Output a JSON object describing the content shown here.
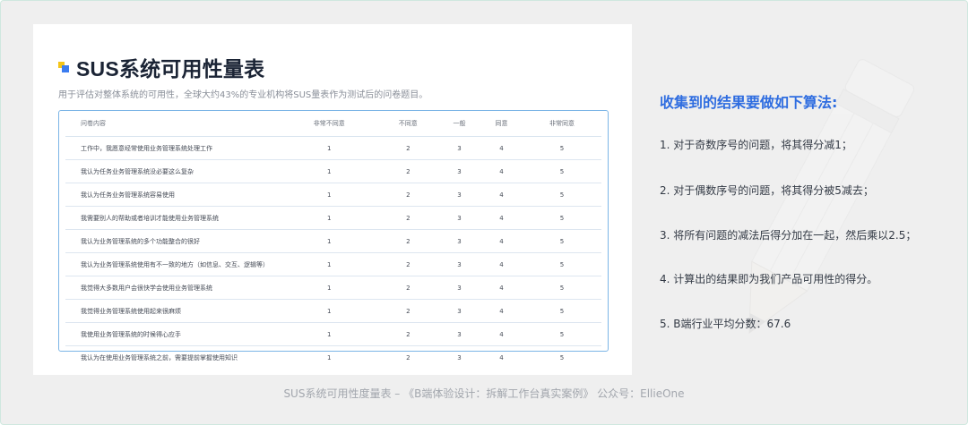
{
  "card": {
    "title": "SUS系统可用性量表",
    "subtitle": "用于评估对整体系统的可用性，全球大约43%的专业机构将SUS量表作为测试后的问卷题目。"
  },
  "table": {
    "headers": [
      "问卷内容",
      "非常不同意",
      "不同意",
      "一般",
      "同意",
      "非常同意"
    ],
    "rows": [
      [
        "工作中，我愿意经常使用业务管理系统处理工作",
        "1",
        "2",
        "3",
        "4",
        "5"
      ],
      [
        "我认为任务业务管理系统没必要这么复杂",
        "1",
        "2",
        "3",
        "4",
        "5"
      ],
      [
        "我认为任务业务管理系统容易使用",
        "1",
        "2",
        "3",
        "4",
        "5"
      ],
      [
        "我需要别人的帮助或者培训才能使用业务管理系统",
        "1",
        "2",
        "3",
        "4",
        "5"
      ],
      [
        "我认为业务管理系统的多个功能整合的很好",
        "1",
        "2",
        "3",
        "4",
        "5"
      ],
      [
        "我认为业务管理系统使用有不一致的地方（如信息、交互、逻辑等）",
        "1",
        "2",
        "3",
        "4",
        "5"
      ],
      [
        "我觉得大多数用户会很快学会使用业务管理系统",
        "1",
        "2",
        "3",
        "4",
        "5"
      ],
      [
        "我觉得业务管理系统使用起来很麻烦",
        "1",
        "2",
        "3",
        "4",
        "5"
      ],
      [
        "我使用业务管理系统的时候得心应手",
        "1",
        "2",
        "3",
        "4",
        "5"
      ],
      [
        "我认为在使用业务管理系统之前，需要提前掌握使用知识",
        "1",
        "2",
        "3",
        "4",
        "5"
      ]
    ]
  },
  "algorithm": {
    "title": "收集到的结果要做如下算法:",
    "steps": [
      "1. 对于奇数序号的问题，将其得分减1；",
      "2. 对于偶数序号的问题，将其得分被5减去；",
      "3. 将所有问题的减法后得分加在一起，然后乘以2.5；",
      "4. 计算出的结果即为我们产品可用性的得分。",
      "5. B端行业平均分数：67.6"
    ]
  },
  "footer": "SUS系统可用性度量表 – 《B端体验设计：拆解工作台真实案例》 公众号：EllieOne",
  "icons": {
    "logo": "blocks-logo-icon",
    "decoration": "pencil-icon"
  },
  "colors": {
    "accent": "#2f6de0",
    "logo_yellow": "#f5c518",
    "logo_blue": "#3b7cf0",
    "table_border": "#7cb5e6",
    "frame_border": "#cfe8df",
    "background": "#efefef"
  }
}
